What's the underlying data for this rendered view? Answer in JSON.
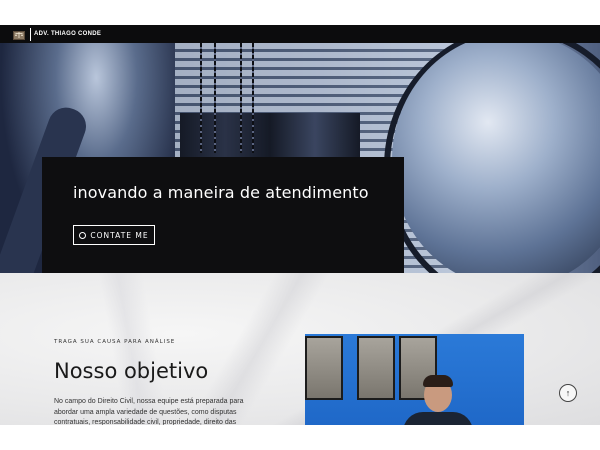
{
  "header": {
    "brand": "ADV. THIAGO CONDE"
  },
  "hero": {
    "title": "inovando a maneira de atendimento",
    "cta_label": "CONTATE ME"
  },
  "objective": {
    "eyebrow": "TRAGA SUA CAUSA PARA ANÁLISE",
    "title": "Nosso objetivo",
    "body": "No campo do Direito Civil, nossa equipe está preparada para abordar uma ampla variedade de questões, como disputas contratuais, responsabilidade civil, propriedade, direito das"
  },
  "icons": {
    "logo": "scales-of-justice-logo-icon",
    "cta": "whatsapp-icon",
    "scroll": "arrow-up-icon"
  },
  "colors": {
    "topbar": "#0c0c0d",
    "hero_panel": "#0e0e10",
    "photo_bg": "#2b7ad8"
  }
}
